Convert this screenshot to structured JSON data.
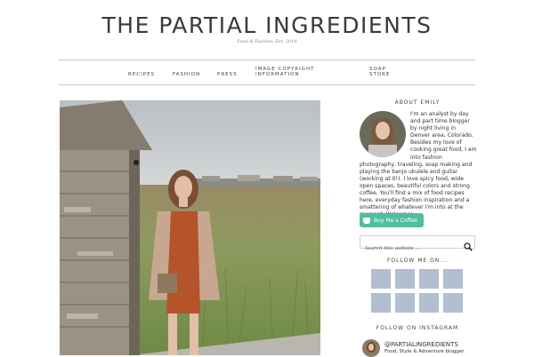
{
  "header": {
    "title": "THE PARTIAL INGREDIENTS",
    "tagline": "Food & Fashion. Est. 2010"
  },
  "nav": {
    "items": [
      "RECIPES",
      "FASHION",
      "PRESS",
      "IMAGE COPYRIGHT INFORMATION",
      "SOAP STORE"
    ],
    "image_copyright_line1": "IMAGE COPYRIGHT",
    "image_copyright_line2": "INFORMATION",
    "soap_line1": "SOAP",
    "soap_line2": "STORE"
  },
  "sidebar": {
    "about_heading": "ABOUT EMILY",
    "about_text": "I'm an analyst by day and part time blogger by night living in Denver area, Colorado. Besides my love of cooking great food, I am into fashion photography, traveling, soap making and playing the banjo ukulele and guitar (working at it!). I love spicy food, wide open spaces, beautiful colors and strong coffee. You'll find a mix of food recipes here, everyday fashion inspiration and a smattering of whatever I'm into at the moment. Welcome!",
    "coffee_button": "Buy Me a Coffee",
    "search_placeholder": "Search this website ...",
    "follow_heading": "FOLLOW ME ON...",
    "social_tiles": [
      "social-icon",
      "social-icon",
      "social-icon",
      "social-icon",
      "social-icon",
      "social-icon",
      "social-icon",
      "social-icon"
    ],
    "instagram_heading": "FOLLOW ON INSTAGRAM",
    "instagram_handle": "@PARTIALINGREDIENTS",
    "instagram_sub": "Food, Style & Adventure blogger."
  },
  "colors": {
    "tile": "#b2bed1",
    "coffee_button": "#4fbf9f",
    "nav_line": "#c9c9c9"
  }
}
